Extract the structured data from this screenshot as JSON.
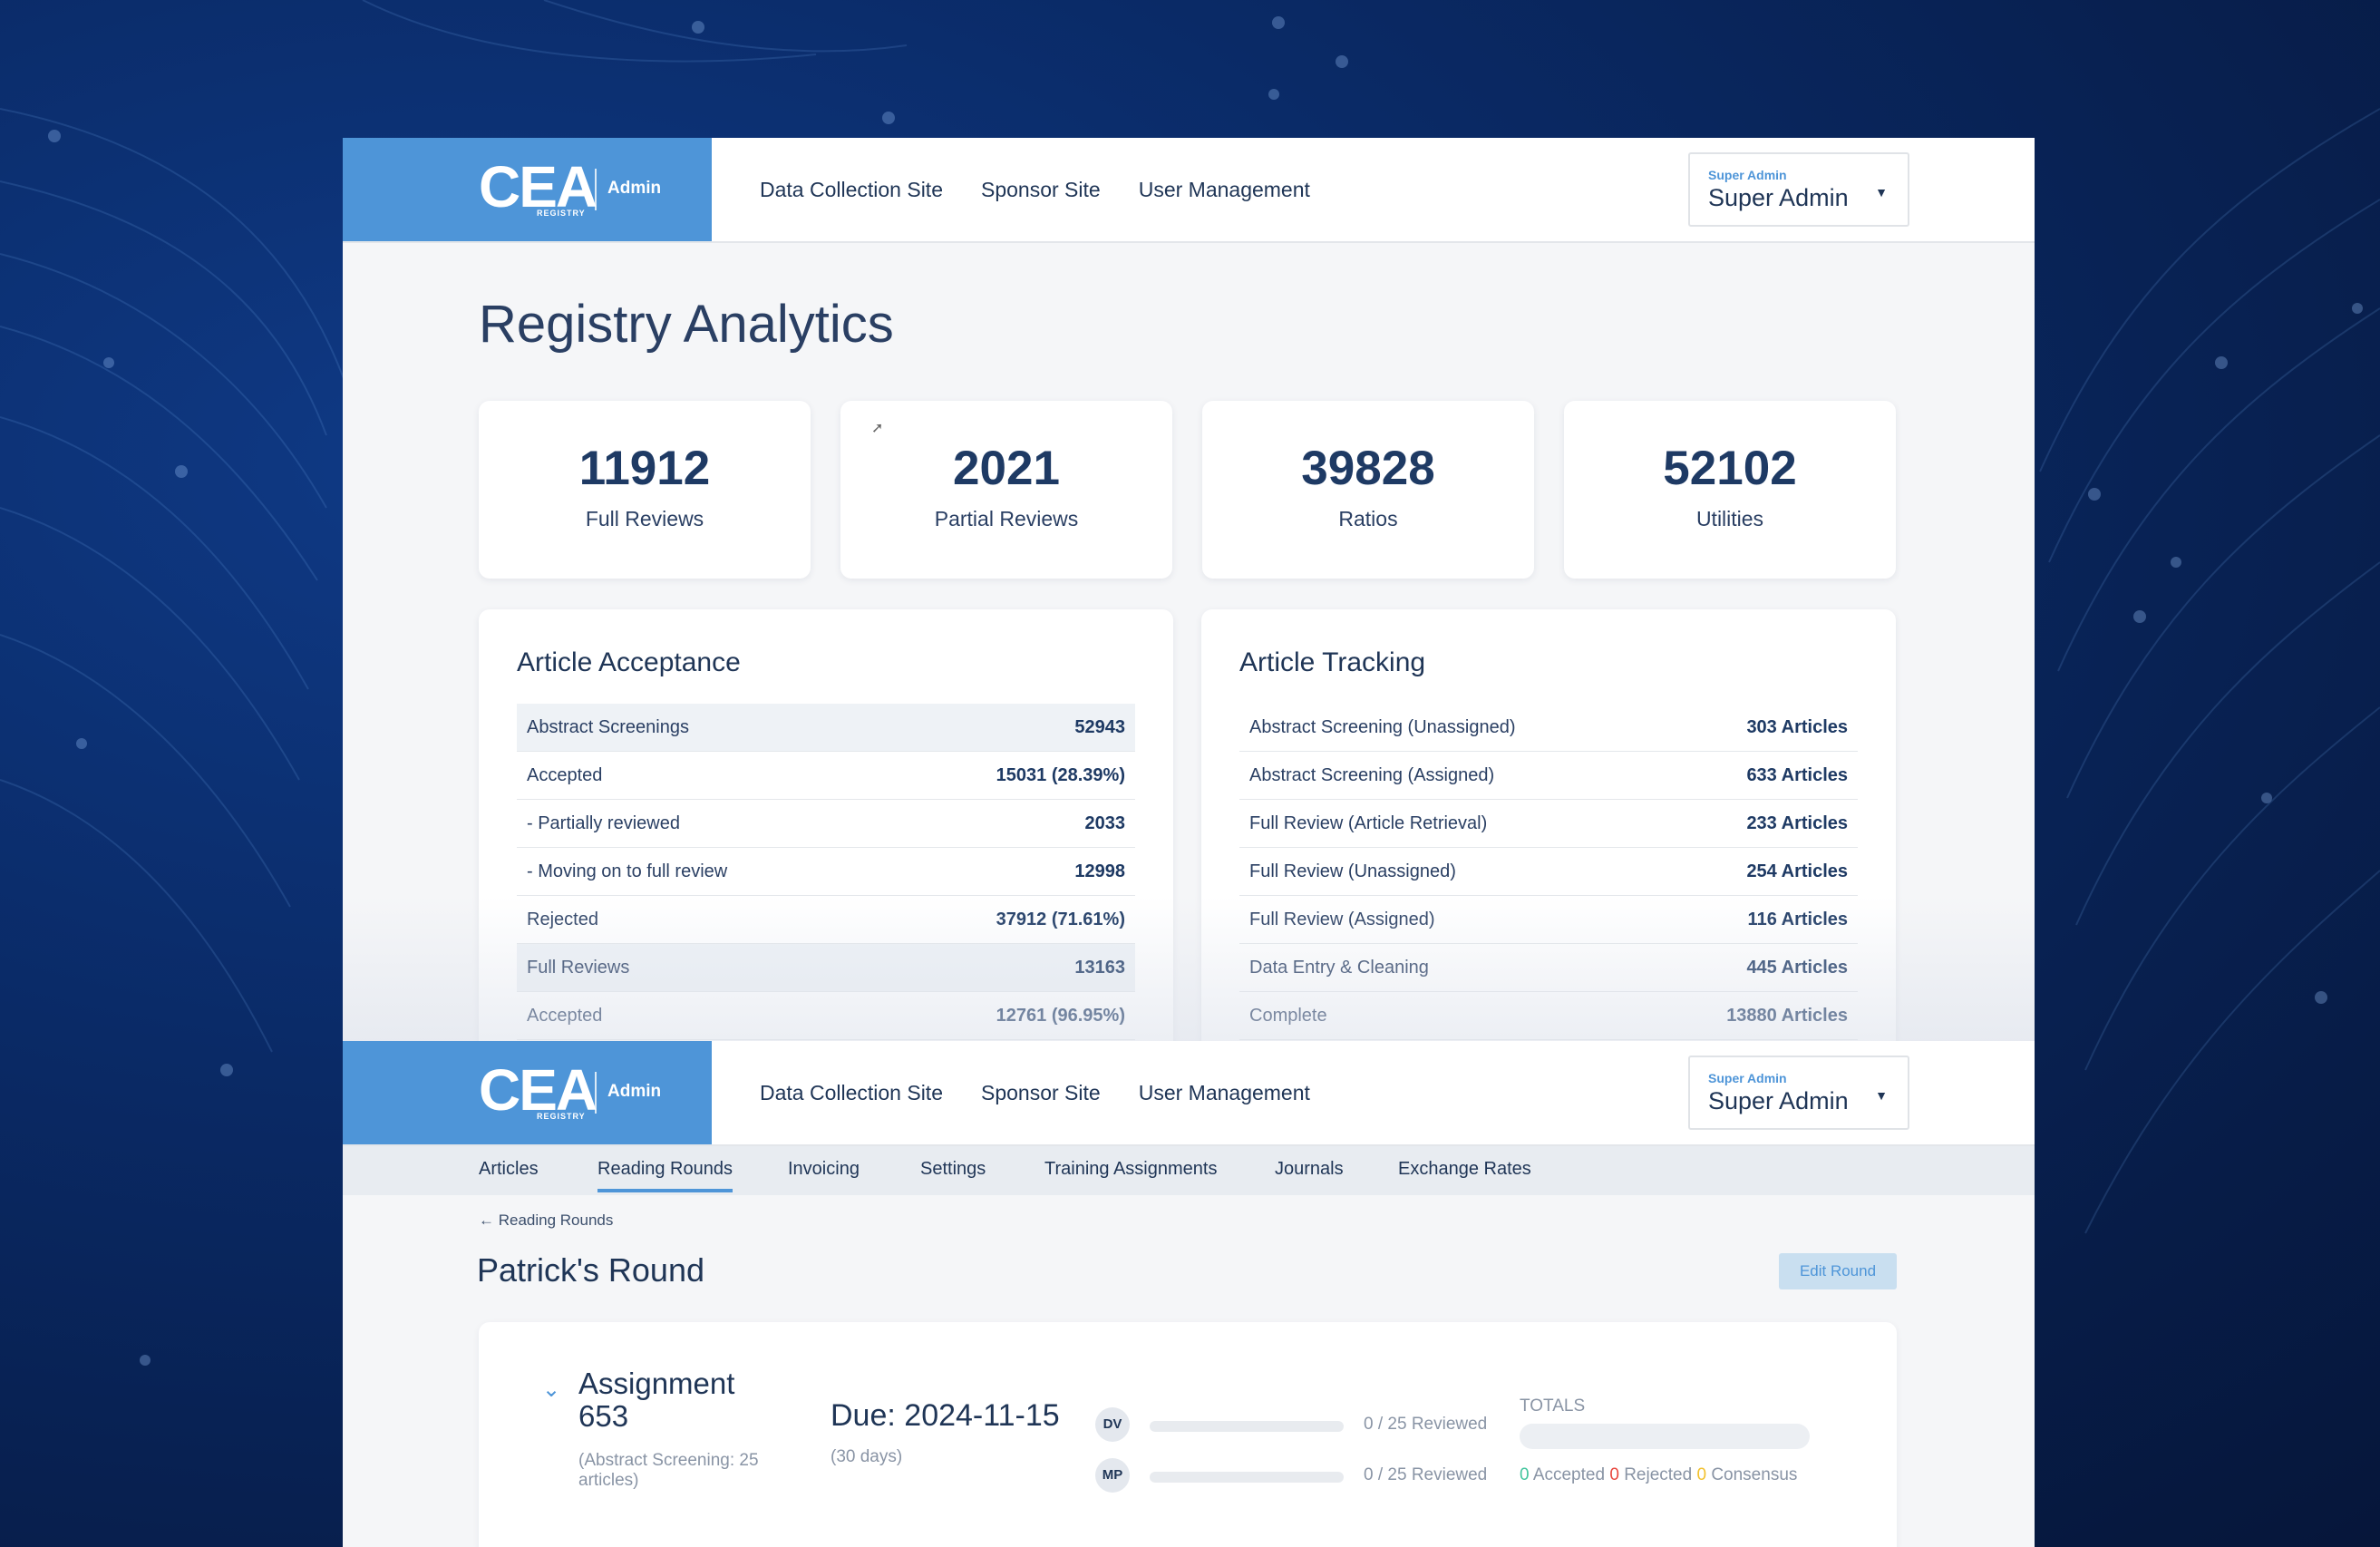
{
  "brand": {
    "name": "CEA",
    "sub": "REGISTRY",
    "section": "Admin"
  },
  "nav": [
    "Data Collection Site",
    "Sponsor Site",
    "User Management"
  ],
  "user": {
    "role": "Super Admin",
    "name": "Super Admin"
  },
  "analytics": {
    "title": "Registry Analytics",
    "stats": [
      {
        "value": "11912",
        "label": "Full Reviews"
      },
      {
        "value": "2021",
        "label": "Partial Reviews"
      },
      {
        "value": "39828",
        "label": "Ratios"
      },
      {
        "value": "52102",
        "label": "Utilities"
      }
    ],
    "acceptance": {
      "title": "Article Acceptance",
      "rows": [
        {
          "label": "Abstract Screenings",
          "value": "52943"
        },
        {
          "label": "Accepted",
          "value": "15031 (28.39%)"
        },
        {
          "label": "- Partially reviewed",
          "value": "2033"
        },
        {
          "label": "- Moving on to full review",
          "value": "12998"
        },
        {
          "label": "Rejected",
          "value": "37912 (71.61%)"
        },
        {
          "label": "Full Reviews",
          "value": "13163"
        },
        {
          "label": "Accepted",
          "value": "12761 (96.95%)"
        }
      ]
    },
    "tracking": {
      "title": "Article Tracking",
      "rows": [
        {
          "label": "Abstract Screening (Unassigned)",
          "value": "303 Articles"
        },
        {
          "label": "Abstract Screening (Assigned)",
          "value": "633 Articles"
        },
        {
          "label": "Full Review (Article Retrieval)",
          "value": "233 Articles"
        },
        {
          "label": "Full Review (Unassigned)",
          "value": "254 Articles"
        },
        {
          "label": "Full Review (Assigned)",
          "value": "116 Articles"
        },
        {
          "label": "Data Entry & Cleaning",
          "value": "445 Articles"
        },
        {
          "label": "Complete",
          "value": "13880 Articles"
        }
      ]
    }
  },
  "rounds": {
    "tabs": [
      "Articles",
      "Reading Rounds",
      "Invoicing",
      "Settings",
      "Training Assignments",
      "Journals",
      "Exchange Rates"
    ],
    "active_tab": "Reading Rounds",
    "back": "← Reading Rounds",
    "title": "Patrick's Round",
    "edit": "Edit Round",
    "assignment": {
      "title": "Assignment 653",
      "subtitle": "(Abstract Screening: 25 articles)",
      "due_prefix": "Due:",
      "due_date": "2024-11-15",
      "due_days": "(30 days)",
      "reviewers": [
        {
          "initials": "DV",
          "status": "0 / 25 Reviewed",
          "progress": 0
        },
        {
          "initials": "MP",
          "status": "0 / 25 Reviewed",
          "progress": 0
        }
      ],
      "totals_label": "TOTALS",
      "totals": {
        "accepted": "0",
        "accepted_label": "Accepted",
        "rejected": "0",
        "rejected_label": "Rejected",
        "consensus": "0",
        "consensus_label": "Consensus"
      }
    }
  },
  "colors": {
    "brand": "#4e95d8",
    "navy": "#1f3556",
    "accepted": "#43c59e",
    "rejected": "#e8483f",
    "consensus": "#f2c12e"
  }
}
